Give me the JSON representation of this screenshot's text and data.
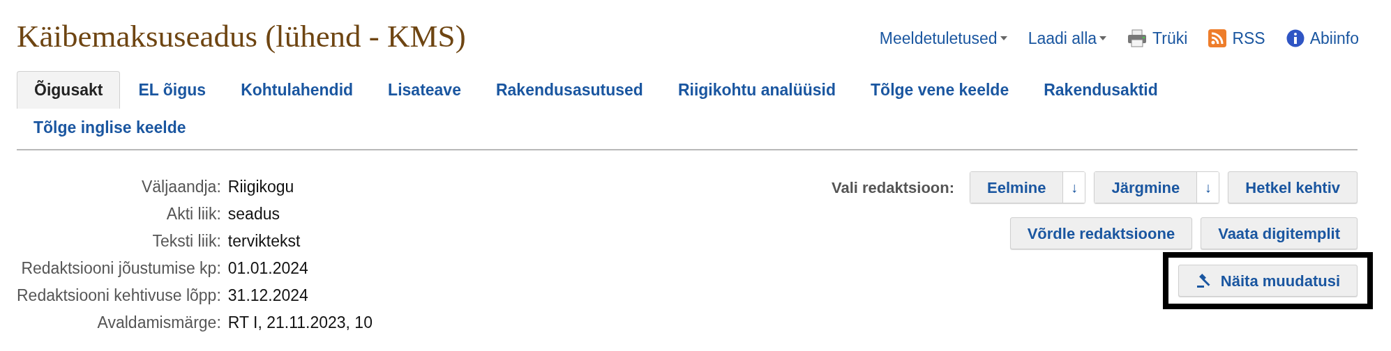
{
  "title": "Käibemaksuseadus (lühend - KMS)",
  "top_links": [
    {
      "label": "Meeldetuletused",
      "kind": "dropdown"
    },
    {
      "label": "Laadi alla",
      "kind": "dropdown"
    },
    {
      "label": "Trüki",
      "kind": "print"
    },
    {
      "label": "RSS",
      "kind": "rss"
    },
    {
      "label": "Abiinfo",
      "kind": "info"
    }
  ],
  "tabs": [
    {
      "label": "Õigusakt",
      "selected": true
    },
    {
      "label": "EL õigus",
      "selected": false
    },
    {
      "label": "Kohtulahendid",
      "selected": false
    },
    {
      "label": "Lisateave",
      "selected": false
    },
    {
      "label": "Rakendusasutused",
      "selected": false
    },
    {
      "label": "Riigikohtu analüüsid",
      "selected": false
    },
    {
      "label": "Tõlge vene keelde",
      "selected": false
    },
    {
      "label": "Rakendusaktid",
      "selected": false
    },
    {
      "label": "Tõlge inglise keelde",
      "selected": false
    }
  ],
  "details": [
    {
      "label": "Väljaandja:",
      "value": "Riigikogu"
    },
    {
      "label": "Akti liik:",
      "value": "seadus"
    },
    {
      "label": "Teksti liik:",
      "value": "terviktekst"
    },
    {
      "label": "Redaktsiooni jõustumise kp:",
      "value": "01.01.2024"
    },
    {
      "label": "Redaktsiooni kehtivuse lõpp:",
      "value": "31.12.2024"
    },
    {
      "label": "Avaldamismärge:",
      "value": "RT I, 21.11.2023, 10"
    }
  ],
  "version_select": {
    "label": "Vali redaktsioon:",
    "buttons": [
      {
        "label": "Eelmine",
        "kind": "split",
        "arrow": "↓"
      },
      {
        "label": "Järgmine",
        "kind": "split",
        "arrow": "↓"
      },
      {
        "label": "Hetkel kehtiv",
        "kind": "plain"
      }
    ]
  },
  "actions": [
    {
      "label": "Võrdle redaktsioone"
    },
    {
      "label": "Vaata digitemplit"
    }
  ],
  "changes_button": {
    "label": "Näita muudatusi",
    "highlighted": true
  }
}
